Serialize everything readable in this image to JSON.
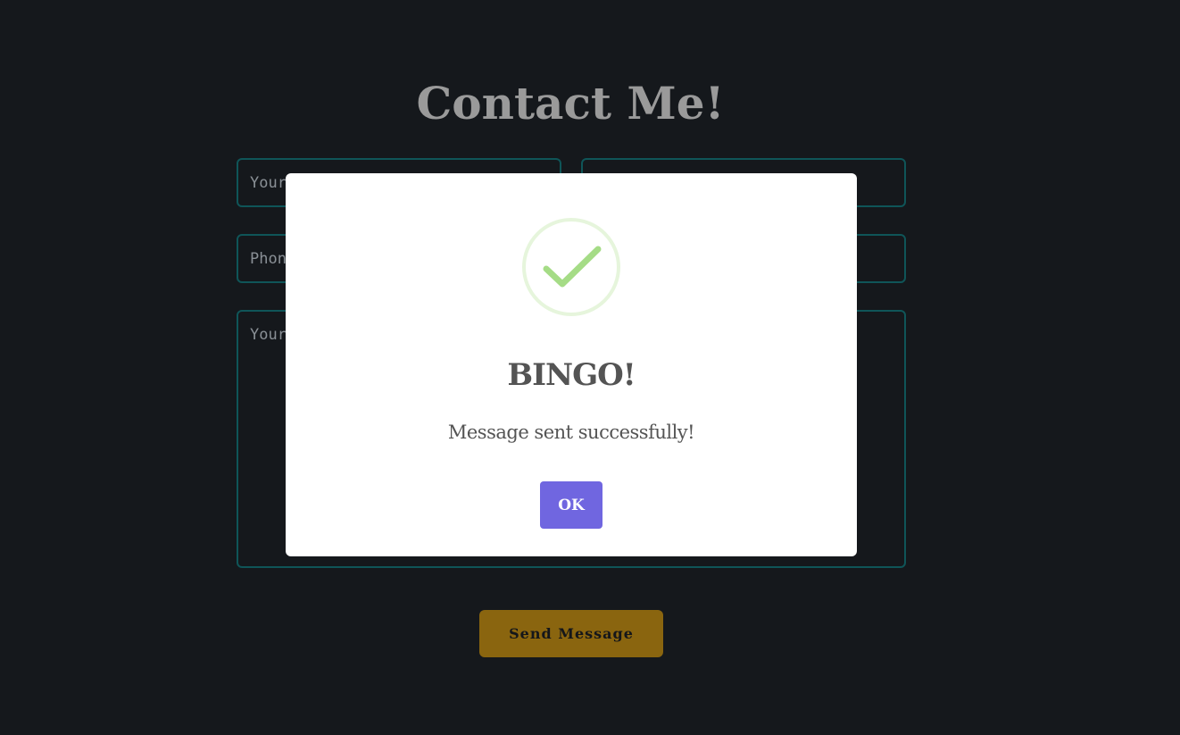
{
  "page": {
    "title": "Contact Me!"
  },
  "form": {
    "name_placeholder": "Your Name",
    "email_placeholder": "",
    "phone_placeholder": "Phone Number",
    "subject_placeholder": "",
    "message_placeholder": "Your Message",
    "send_label": "Send Message"
  },
  "modal": {
    "icon": "success-check-icon",
    "title": "BINGO!",
    "text": "Message sent successfully!",
    "ok_label": "OK"
  },
  "colors": {
    "background": "#15181c",
    "field_border": "#0f5558",
    "send_button": "#8a650f",
    "ok_button": "#7066e0",
    "check": "#a5dc86"
  }
}
